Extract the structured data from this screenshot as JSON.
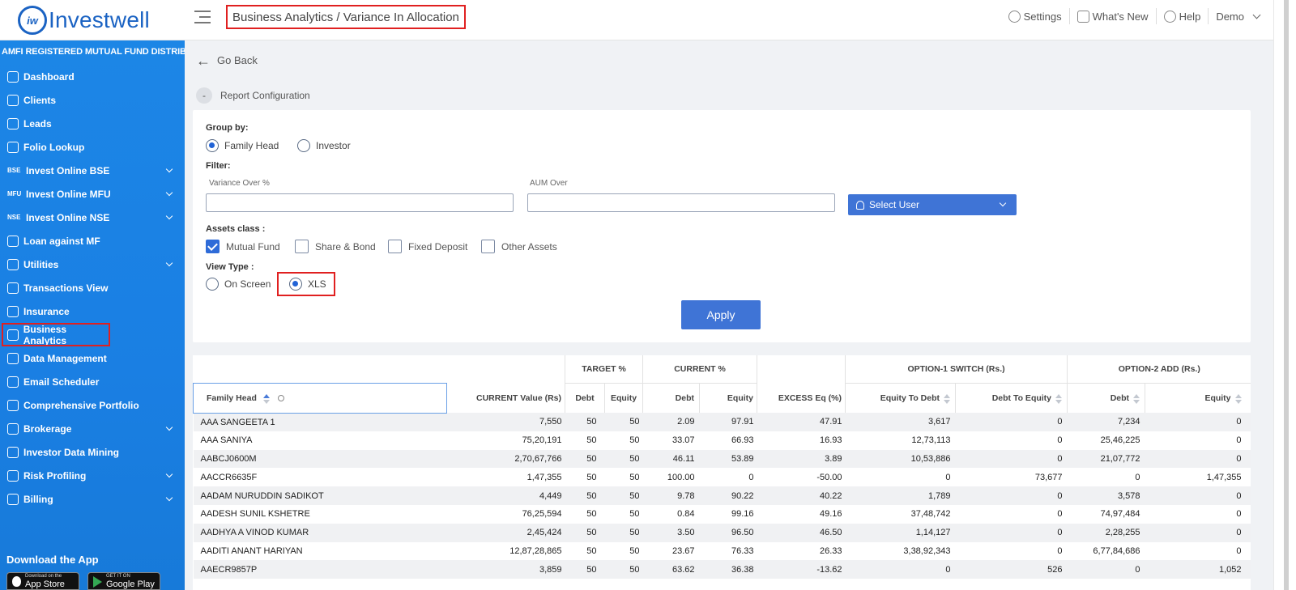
{
  "header": {
    "logo_text": "Investwell",
    "logo_badge": "iw",
    "breadcrumb": "Business Analytics / Variance In Allocation",
    "settings": "Settings",
    "whats_new": "What's New",
    "help": "Help",
    "user": "Demo"
  },
  "sidebar": {
    "amfi": "AMFI REGISTERED MUTUAL FUND DISTRIBUTOR",
    "items": [
      {
        "label": "Dashboard",
        "icon": "home-icon",
        "badge": "",
        "arrow": false
      },
      {
        "label": "Clients",
        "icon": "users-icon",
        "badge": "",
        "arrow": false
      },
      {
        "label": "Leads",
        "icon": "leads-icon",
        "badge": "",
        "arrow": false
      },
      {
        "label": "Folio Lookup",
        "icon": "folio-icon",
        "badge": "",
        "arrow": false
      },
      {
        "label": "Invest Online BSE",
        "icon": "",
        "badge": "BSE",
        "arrow": true
      },
      {
        "label": "Invest Online MFU",
        "icon": "",
        "badge": "MFU",
        "arrow": true
      },
      {
        "label": "Invest Online NSE",
        "icon": "",
        "badge": "NSE",
        "arrow": true
      },
      {
        "label": "Loan against MF",
        "icon": "loan-icon",
        "badge": "",
        "arrow": false
      },
      {
        "label": "Utilities",
        "icon": "utilities-icon",
        "badge": "",
        "arrow": true
      },
      {
        "label": "Transactions View",
        "icon": "transactions-icon",
        "badge": "",
        "arrow": false
      },
      {
        "label": "Insurance",
        "icon": "insurance-icon",
        "badge": "",
        "arrow": false
      },
      {
        "label": "Business Analytics",
        "icon": "analytics-icon",
        "badge": "",
        "arrow": false
      },
      {
        "label": "Data Management",
        "icon": "data-icon",
        "badge": "",
        "arrow": false
      },
      {
        "label": "Email Scheduler",
        "icon": "email-icon",
        "badge": "",
        "arrow": false
      },
      {
        "label": "Comprehensive Portfolio",
        "icon": "portfolio-icon",
        "badge": "",
        "arrow": false
      },
      {
        "label": "Brokerage",
        "icon": "brokerage-icon",
        "badge": "",
        "arrow": true
      },
      {
        "label": "Investor Data Mining",
        "icon": "mining-icon",
        "badge": "",
        "arrow": false
      },
      {
        "label": "Risk Profiling",
        "icon": "risk-icon",
        "badge": "",
        "arrow": true
      },
      {
        "label": "Billing",
        "icon": "billing-icon",
        "badge": "",
        "arrow": true
      }
    ],
    "download_title": "Download the App",
    "app_store_small": "Download on the",
    "app_store": "App Store",
    "play_small": "GET IT ON",
    "play": "Google Play"
  },
  "main": {
    "go_back": "Go Back",
    "report_config": "Report Configuration",
    "group_by_label": "Group by:",
    "group_family_head": "Family Head",
    "group_investor": "Investor",
    "filter_label": "Filter:",
    "variance_label": "Variance Over %",
    "aum_label": "AUM Over",
    "select_user": "Select User",
    "assets_label": "Assets class :",
    "asset_mf": "Mutual Fund",
    "asset_sb": "Share & Bond",
    "asset_fd": "Fixed Deposit",
    "asset_other": "Other Assets",
    "view_type_label": "View Type :",
    "view_on_screen": "On Screen",
    "view_xls": "XLS",
    "apply": "Apply"
  },
  "table": {
    "group_headers": {
      "target": "TARGET %",
      "current": "CURRENT %",
      "option1": "OPTION-1 SWITCH (Rs.)",
      "option2": "OPTION-2 ADD (Rs.)"
    },
    "columns": {
      "family_head": "Family Head",
      "current_value": "CURRENT Value (Rs)",
      "t_debt": "Debt",
      "t_equity": "Equity",
      "c_debt": "Debt",
      "c_equity": "Equity",
      "excess": "EXCESS Eq (%)",
      "eq_to_debt": "Equity To Debt",
      "debt_to_eq": "Debt To Equity",
      "o2_debt": "Debt",
      "o2_equity": "Equity"
    },
    "rows": [
      [
        "AAA SANGEETA 1",
        "7,550",
        "50",
        "50",
        "2.09",
        "97.91",
        "47.91",
        "3,617",
        "0",
        "7,234",
        "0"
      ],
      [
        "AAA SANIYA",
        "75,20,191",
        "50",
        "50",
        "33.07",
        "66.93",
        "16.93",
        "12,73,113",
        "0",
        "25,46,225",
        "0"
      ],
      [
        "AABCJ0600M",
        "2,70,67,766",
        "50",
        "50",
        "46.11",
        "53.89",
        "3.89",
        "10,53,886",
        "0",
        "21,07,772",
        "0"
      ],
      [
        "AACCR6635F",
        "1,47,355",
        "50",
        "50",
        "100.00",
        "0",
        "-50.00",
        "0",
        "73,677",
        "0",
        "1,47,355"
      ],
      [
        "AADAM NURUDDIN SADIKOT",
        "4,449",
        "50",
        "50",
        "9.78",
        "90.22",
        "40.22",
        "1,789",
        "0",
        "3,578",
        "0"
      ],
      [
        "AADESH SUNIL KSHETRE",
        "76,25,594",
        "50",
        "50",
        "0.84",
        "99.16",
        "49.16",
        "37,48,742",
        "0",
        "74,97,484",
        "0"
      ],
      [
        "AADHYA A VINOD KUMAR",
        "2,45,424",
        "50",
        "50",
        "3.50",
        "96.50",
        "46.50",
        "1,14,127",
        "0",
        "2,28,255",
        "0"
      ],
      [
        "AADITI ANANT HARIYAN",
        "12,87,28,865",
        "50",
        "50",
        "23.67",
        "76.33",
        "26.33",
        "3,38,92,343",
        "0",
        "6,77,84,686",
        "0"
      ],
      [
        "AAECR9857P",
        "3,859",
        "50",
        "50",
        "63.62",
        "36.38",
        "-13.62",
        "0",
        "526",
        "0",
        "1,052"
      ]
    ]
  }
}
